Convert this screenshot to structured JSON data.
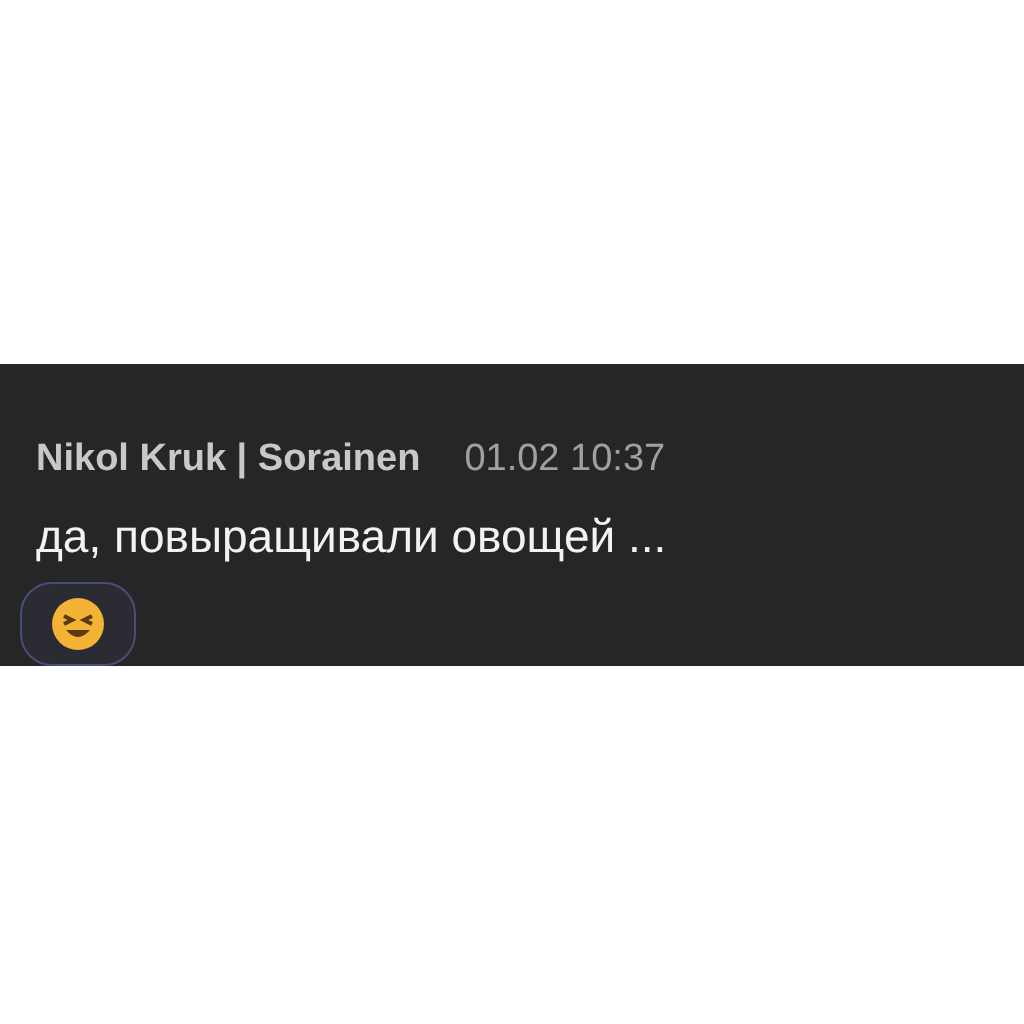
{
  "message": {
    "author": "Nikol Kruk | Sorainen",
    "time": "01.02 10:37",
    "text": "да, повыращивали овощей ..."
  },
  "reactions": [
    {
      "kind": "laugh"
    }
  ]
}
